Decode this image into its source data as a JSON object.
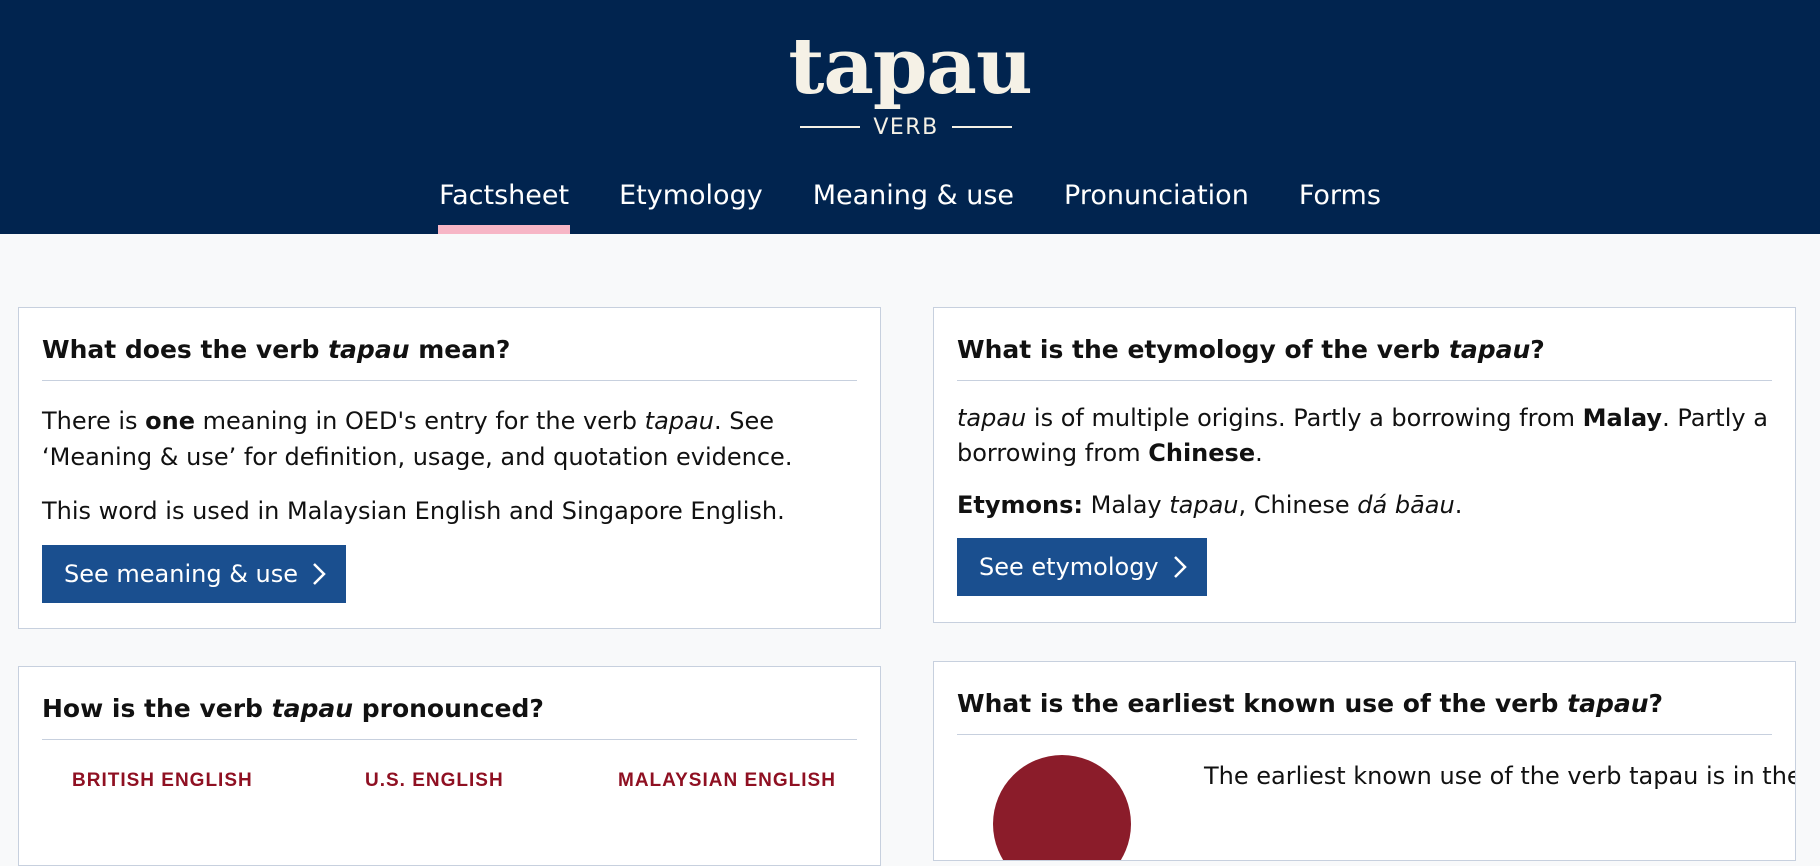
{
  "header": {
    "headword": "tapau",
    "part_of_speech": "VERB",
    "tabs": [
      {
        "label": "Factsheet",
        "active": true
      },
      {
        "label": "Etymology",
        "active": false
      },
      {
        "label": "Meaning & use",
        "active": false
      },
      {
        "label": "Pronunciation",
        "active": false
      },
      {
        "label": "Forms",
        "active": false
      }
    ]
  },
  "colors": {
    "header_bg": "#01244f",
    "active_tab_underline": "#f7b6c6",
    "button_bg": "#1a4f8f",
    "accent_red": "#8f1022"
  },
  "meaning_card": {
    "title_pre": "What does the verb ",
    "title_word": "tapau",
    "title_post": " mean?",
    "p1_a": "There is ",
    "p1_b": "one",
    "p1_c": " meaning in OED's entry for the verb ",
    "p1_d": "tapau",
    "p1_e": ". See ‘Meaning & use’ for definition, usage, and quotation evidence.",
    "p2": "This word is used in Malaysian English and Singapore English.",
    "button": "See meaning & use"
  },
  "etymology_card": {
    "title_pre": "What is the etymology of the verb ",
    "title_word": "tapau",
    "title_post": "?",
    "p1_a": "tapau",
    "p1_b": " is of multiple origins. Partly a borrowing from ",
    "p1_c": "Malay",
    "p1_d": ". Partly a borrowing from ",
    "p1_e": "Chinese",
    "p1_f": ".",
    "etymons_label": "Etymons:",
    "etymons_a": " Malay ",
    "etymons_b": "tapau",
    "etymons_c": ", Chinese ",
    "etymons_d": "dá bāau",
    "etymons_e": ".",
    "button": "See etymology"
  },
  "pronunciation_card": {
    "title_pre": "How is the verb ",
    "title_word": "tapau",
    "title_post": " pronounced?",
    "columns": [
      "BRITISH ENGLISH",
      "U.S. ENGLISH",
      "MALAYSIAN ENGLISH"
    ]
  },
  "earliest_card": {
    "title_pre": "What is the earliest known use of the verb ",
    "title_word": "tapau",
    "title_post": "?",
    "text_fragment": "The earliest known use of the verb tapau is in the"
  }
}
